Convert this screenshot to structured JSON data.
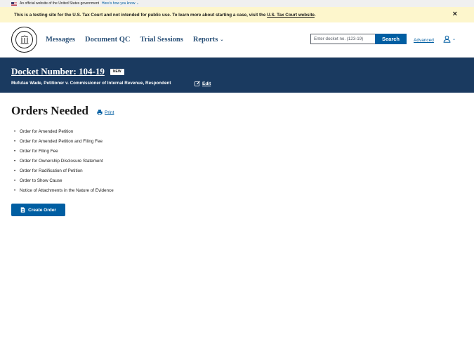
{
  "gov_banner": {
    "text": "An official website of the United States government",
    "how_link": "Here’s how you know"
  },
  "test_banner": {
    "text": "This is a testing site for the U.S. Tax Court and not intended for public use. To learn more about starting a case, visit the ",
    "link": "U.S. Tax Court website",
    "suffix": ".",
    "close": "×"
  },
  "header": {
    "nav": {
      "messages": "Messages",
      "document_qc": "Document QC",
      "trial_sessions": "Trial Sessions",
      "reports": "Reports"
    },
    "search": {
      "placeholder": "Enter docket no. (123-19)",
      "button": "Search"
    },
    "advanced": "Advanced"
  },
  "docket": {
    "title": "Docket Number: 104-19",
    "badge": "NEW",
    "caption": "Mufutau Wade, Petitioner v. Commissioner of Internal Revenue, Respondent",
    "edit": "Edit"
  },
  "main": {
    "title": "Orders Needed",
    "print": "Print",
    "orders": [
      "Order for Amended Petition",
      "Order for Amended Petition and Filing Fee",
      "Order for Filing Fee",
      "Order for Ownership Disclosure Statement",
      "Order for Radification of Petition",
      "Order to Show Cause",
      "Notice of Attachments in the Nature of Evidence"
    ],
    "create_order": "Create Order"
  },
  "colors": {
    "primary": "#005ea2",
    "docket_bg": "#1a3a60",
    "nav_text": "#2c5279",
    "test_banner_bg": "#fdf6cc"
  }
}
